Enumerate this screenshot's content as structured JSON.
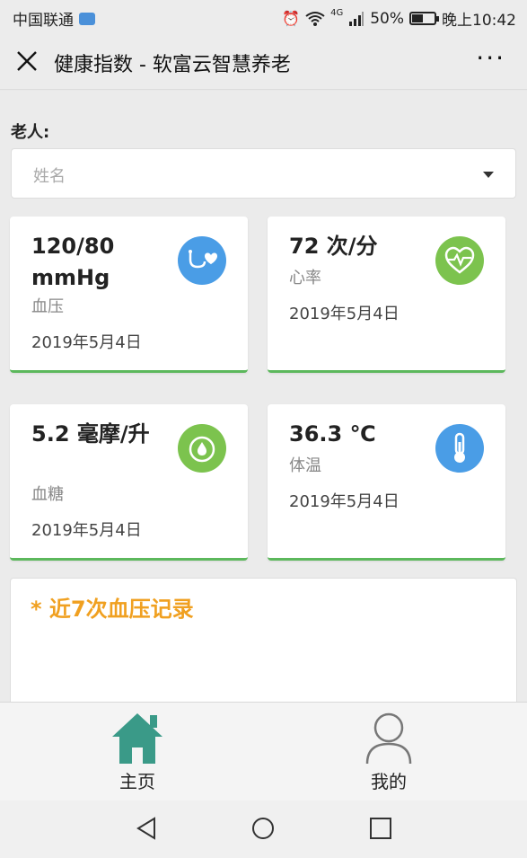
{
  "status_bar": {
    "carrier": "中国联通",
    "network": "4G",
    "battery": "50%",
    "battery_level": 0.5,
    "time": "晚上10:42"
  },
  "titlebar": {
    "title": "健康指数 - 软富云智慧养老",
    "more": "···"
  },
  "form": {
    "elder_label": "老人:",
    "name_placeholder": "姓名"
  },
  "cards": [
    {
      "value": "120/80 mmHg",
      "label": "血压",
      "date": "2019年5月4日",
      "icon": "heart-stethoscope-icon",
      "color": "#4a9de6"
    },
    {
      "value": "72 次/分",
      "label": "心率",
      "date": "2019年5月4日",
      "icon": "heart-rate-icon",
      "color": "#7cc34e"
    },
    {
      "value": "5.2 毫摩/升",
      "label": "血糖",
      "date": "2019年5月4日",
      "icon": "blood-drop-icon",
      "color": "#7cc34e"
    },
    {
      "value": "36.3 ℃",
      "label": "体温",
      "date": "2019年5月4日",
      "icon": "thermometer-icon",
      "color": "#4a9de6"
    }
  ],
  "record": {
    "title": "* 近7次血压记录"
  },
  "tabs": [
    {
      "label": "主页",
      "icon": "home-icon"
    },
    {
      "label": "我的",
      "icon": "user-icon"
    }
  ],
  "colors": {
    "accent_green": "#5cb85c",
    "home_teal": "#3a9a88",
    "record_orange": "#f0a020"
  }
}
